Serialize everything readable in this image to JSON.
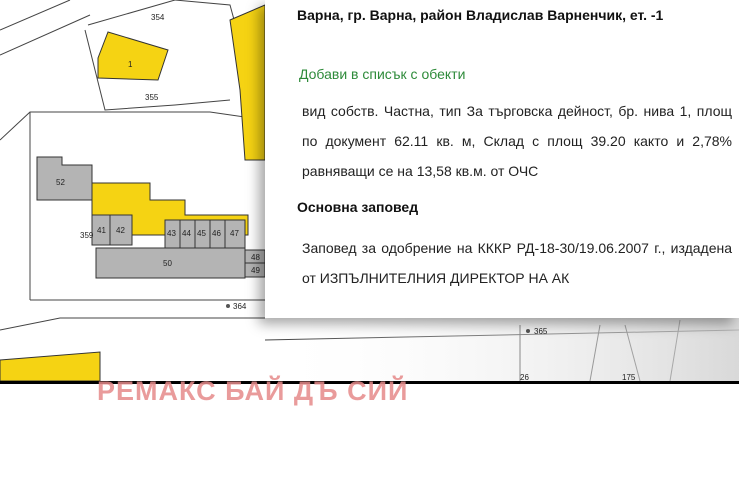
{
  "map": {
    "parcel_numbers": [
      "354",
      "355",
      "1",
      "52",
      "359",
      "41",
      "42",
      "43",
      "44",
      "45",
      "46",
      "47",
      "48",
      "49",
      "50",
      "364",
      "365",
      "175",
      "26"
    ]
  },
  "panel": {
    "address": "Варна, гр. Варна, район Владислав Варненчик, ет. -1",
    "add_to_list": "Добави в списък с обекти",
    "description": "вид собств. Частна, тип За търговска дейност, бр. нива 1, площ по документ 62.11 кв. м, Склад с площ 39.20 както и 2,78% равняващи се на 13,58 кв.м. от ОЧС",
    "section_heading": "Основна заповед",
    "order_text": "Заповед за одобрение на КККР РД-18-30/19.06.2007 г., издадена от ИЗПЪЛНИТЕЛНИЯ ДИРЕКТОР НА АК"
  },
  "watermark": "РЕМАКС БАЙ ДЪ СИЙ",
  "colors": {
    "building_yellow": "#f5d313",
    "building_gray": "#b4b4b4",
    "link_green": "#2e8b3a",
    "watermark_red": "#e68a8a"
  }
}
